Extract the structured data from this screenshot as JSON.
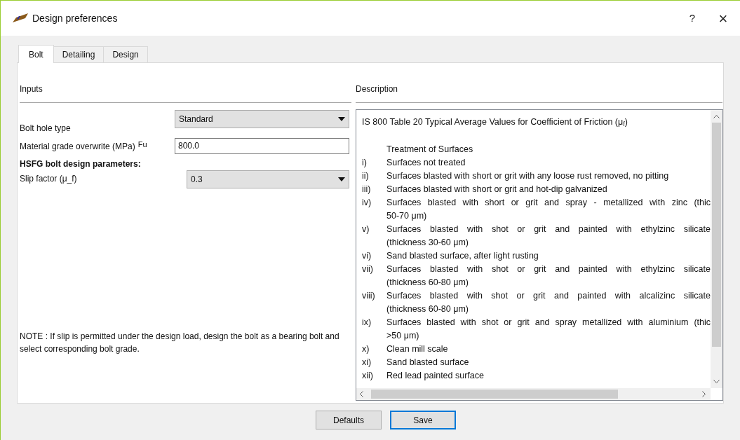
{
  "window": {
    "title": "Design preferences",
    "help": "?",
    "close": "×"
  },
  "tabs": [
    {
      "label": "Bolt",
      "selected": true
    },
    {
      "label": "Detailing",
      "selected": false
    },
    {
      "label": "Design",
      "selected": false
    }
  ],
  "inputs": {
    "heading": "Inputs",
    "fields": [
      {
        "kind": "dropdown",
        "label": "Bolt hole type",
        "value": "Standard"
      },
      {
        "kind": "text",
        "label": "Material grade overwrite (MPa)",
        "prefix": "Fu",
        "value": "800.0"
      },
      {
        "kind": "heading",
        "label": "HSFG bolt design parameters:"
      },
      {
        "kind": "dropdown",
        "label": "Slip factor (μ_f)",
        "value": "0.3"
      }
    ],
    "note": "NOTE : If slip is permitted under the design load, design the bolt as a bearing bolt and select corresponding bolt grade."
  },
  "description": {
    "heading": "Description",
    "title": "IS 800 Table 20 Typical Average Values for Coefficient of Friction (μ$_{f}$)",
    "column_heading": "Treatment of Surfaces",
    "items": [
      {
        "number": "i)",
        "lines": [
          "Surfaces not treated"
        ]
      },
      {
        "number": "ii)",
        "lines": [
          "Surfaces blasted with short or grit with any loose rust removed, no pitting"
        ]
      },
      {
        "number": "iii)",
        "lines": [
          "Surfaces blasted with short or grit and hot-dip galvanized"
        ]
      },
      {
        "number": "iv)",
        "lines": [
          "Surfaces blasted with short or grit and spray - metallized with zinc (thic",
          "50-70 μm)"
        ]
      },
      {
        "number": "v)",
        "lines": [
          "Surfaces blasted with shot or grit and painted with ethylzinc silicate",
          "(thickness 30-60 μm)"
        ]
      },
      {
        "number": "vi)",
        "lines": [
          "Sand blasted surface, after light rusting"
        ]
      },
      {
        "number": "vii)",
        "lines": [
          "Surfaces blasted with shot or grit and painted with ethylzinc silicate",
          "(thickness 60-80 μm)"
        ]
      },
      {
        "number": "viii)",
        "lines": [
          "Surfaces blasted with shot or grit and painted with alcalizinc silicate",
          "(thickness 60-80 μm)"
        ]
      },
      {
        "number": "ix)",
        "lines": [
          "Surfaces blasted with shot or grit and spray metallized with aluminium (thic",
          ">50 μm)"
        ]
      },
      {
        "number": "x)",
        "lines": [
          "Clean mill scale"
        ]
      },
      {
        "number": "xi)",
        "lines": [
          "Sand blasted surface"
        ]
      },
      {
        "number": "xii)",
        "lines": [
          "Red lead painted surface"
        ]
      }
    ]
  },
  "buttons": [
    {
      "label": "Defaults",
      "focused": false
    },
    {
      "label": "Save",
      "focused": true
    }
  ]
}
